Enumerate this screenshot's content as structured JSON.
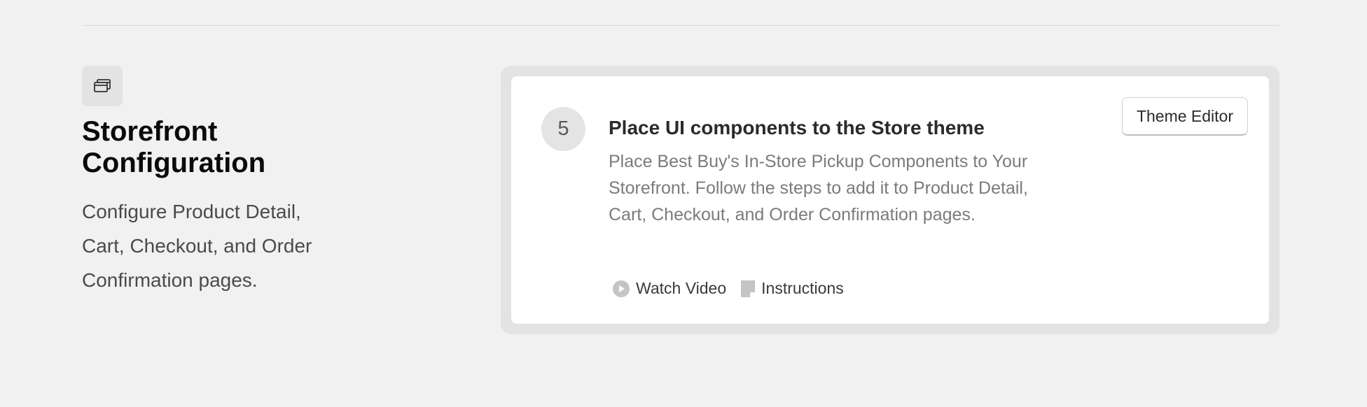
{
  "section": {
    "icon": "windows-stack-icon",
    "title": "Storefront Configuration",
    "description": "Configure Product Detail, Cart, Checkout, and Order Confirmation pages."
  },
  "step": {
    "number": "5",
    "title": "Place UI components to the Store theme",
    "description": "Place Best Buy's In-Store Pickup Components to Your Storefront. Follow the steps to add it to Product Detail, Cart, Checkout, and Order Confirmation pages.",
    "action_button": "Theme Editor",
    "links": [
      {
        "icon": "play-circle-icon",
        "label": "Watch Video"
      },
      {
        "icon": "document-icon",
        "label": "Instructions"
      }
    ]
  },
  "colors": {
    "background": "#f1f1f1",
    "card_border": "#e3e3e3",
    "card": "#ffffff",
    "title_text": "#0a0a0a",
    "muted_text": "#7b7b7b"
  }
}
